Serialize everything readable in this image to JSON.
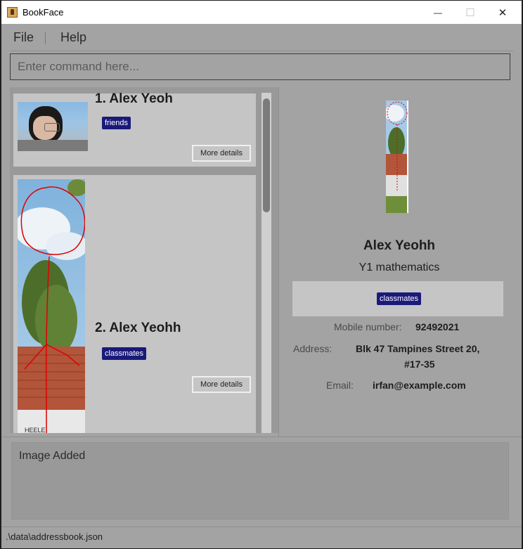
{
  "window": {
    "title": "BookFace",
    "minimize_glyph": "—",
    "maximize_glyph": "☐",
    "close_glyph": "✕"
  },
  "menu": {
    "file": "File",
    "help": "Help"
  },
  "command": {
    "placeholder": "Enter command here..."
  },
  "persons": [
    {
      "index_name": "1. Alex Yeoh",
      "tag": "friends",
      "button": "More details"
    },
    {
      "index_name": "2. Alex Yeohh",
      "tag": "classmates",
      "button": "More details"
    }
  ],
  "detail": {
    "name": "Alex Yeohh",
    "description": "Y1 mathematics",
    "tag": "classmates",
    "mobile_label": "Mobile number:",
    "mobile": "92492021",
    "address_label": "Address:",
    "address_line1": "Blk 47 Tampines Street 20,",
    "address_line2": "#17-35",
    "email_label": "Email:",
    "email": "irfan@example.com"
  },
  "result": "Image Added",
  "status": ".\\data\\addressbook.json",
  "icons": {
    "app": "bookface-app-icon",
    "minimize": "minimize-icon",
    "maximize": "maximize-icon",
    "close": "close-icon"
  },
  "colors": {
    "tag_bg": "#1a1a7a",
    "panel": "#a3a3a3",
    "card": "#c5c5c5",
    "drawing_stroke": "#e00000"
  }
}
